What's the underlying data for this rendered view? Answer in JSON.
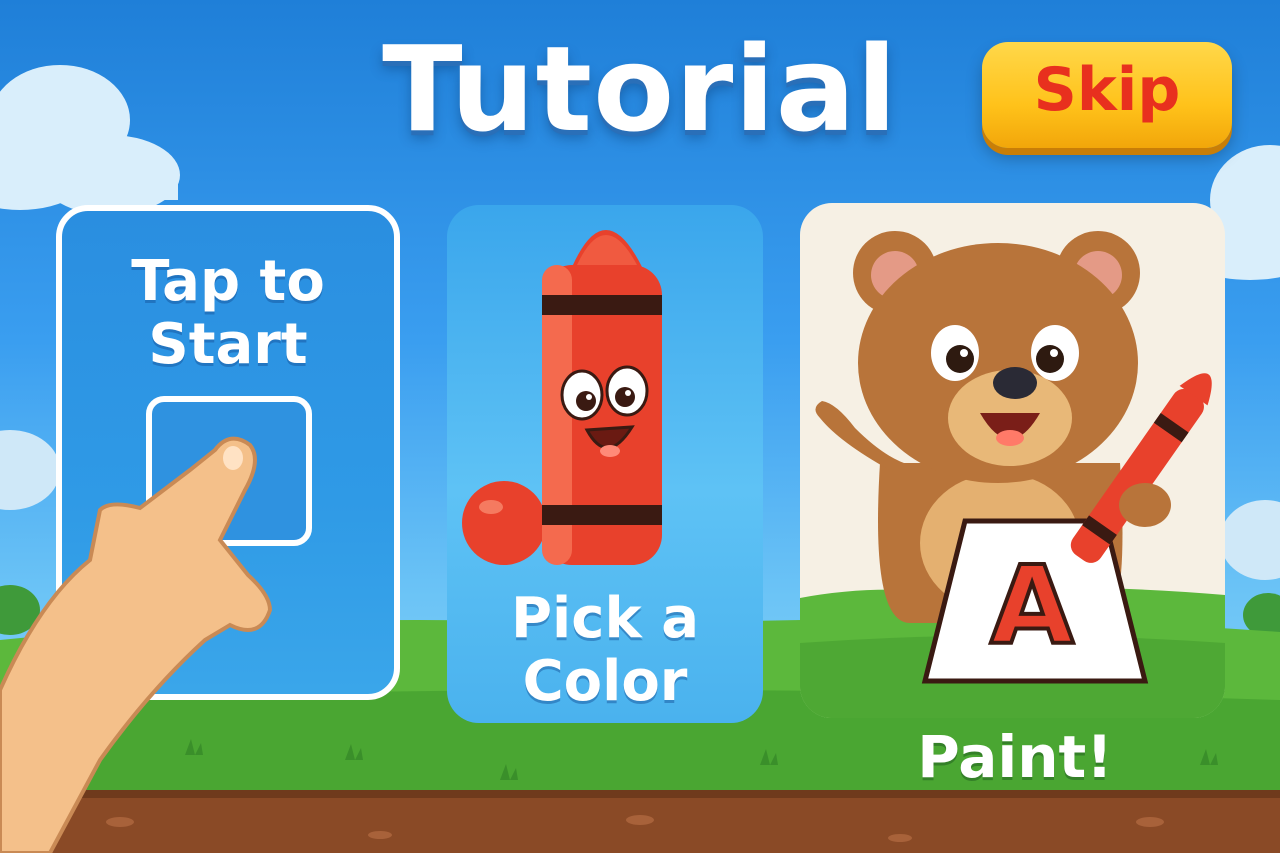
{
  "screen": {
    "title": "Tutorial",
    "skip_label": "Skip"
  },
  "steps": [
    {
      "label_line1": "Tap to",
      "label_line2": "Start",
      "icon": "pointing-hand-icon"
    },
    {
      "label_line1": "Pick a",
      "label_line2": "Color",
      "icon": "crayon-character-icon"
    },
    {
      "label": "Paint!",
      "icon": "bear-painting-icon",
      "sign_letter": "A"
    }
  ],
  "colors": {
    "sky": "#2f92e0",
    "skip_button": "#ffc21a",
    "skip_text": "#e8301e",
    "crayon": "#e8412c",
    "grass": "#5cb83c",
    "bear": "#b8743a"
  }
}
